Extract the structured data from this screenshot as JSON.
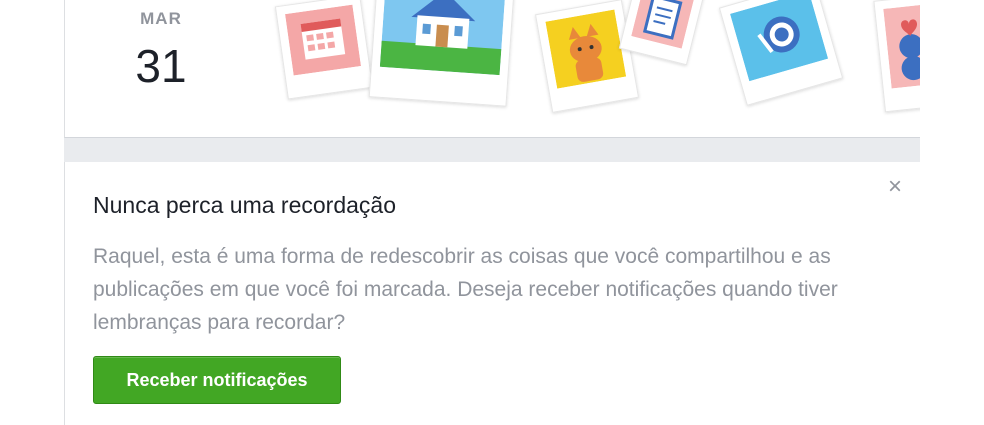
{
  "header": {
    "month": "MAR",
    "day": "31"
  },
  "icons": [
    "calendar-icon",
    "house-icon",
    "cat-icon",
    "document-icon",
    "globe-icon",
    "heart-icon"
  ],
  "notice": {
    "title": "Nunca perca uma recordação",
    "body": "Raquel, esta é uma forma de redescobrir as coisas que você compartilhou e as publicações em que você foi marcada. Deseja receber notificações quando tiver lembranças para recordar?",
    "button_label": "Receber notificações",
    "close_symbol": "×"
  },
  "colors": {
    "button_green": "#42a724",
    "muted_text": "#90949c",
    "page_gray": "#e9ebee"
  }
}
